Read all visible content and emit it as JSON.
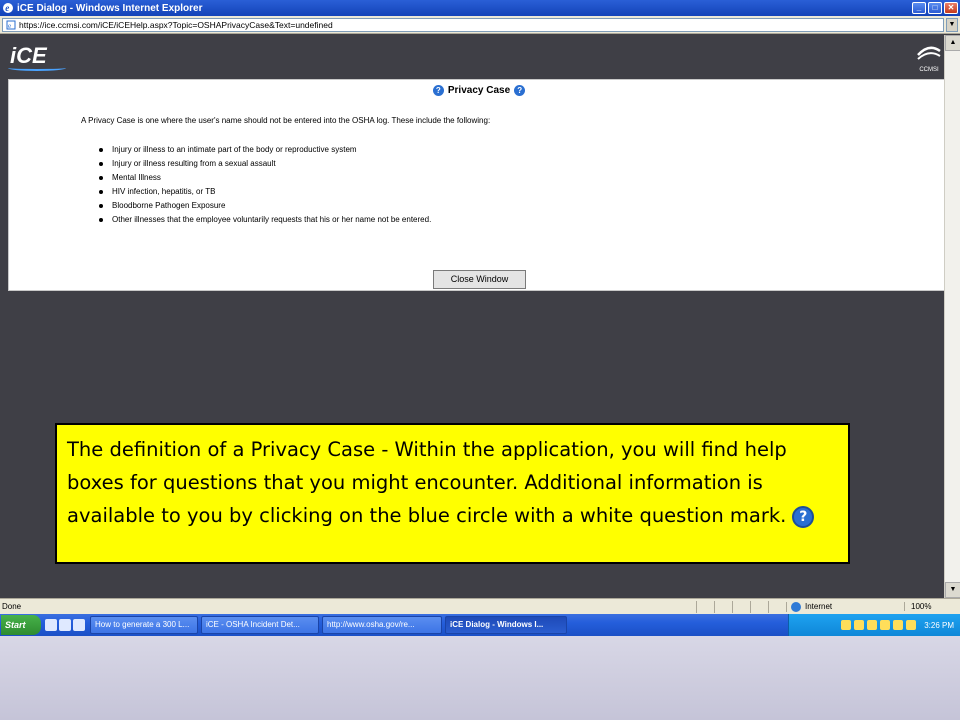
{
  "window": {
    "title": "iCE Dialog - Windows Internet Explorer",
    "url": "https://ice.ccmsi.com/iCE/iCEHelp.aspx?Topic=OSHAPrivacyCase&Text=undefined"
  },
  "header": {
    "logo_text": "iCE",
    "brand_text": "CCMSI"
  },
  "dialog": {
    "title": "Privacy Case",
    "intro": "A Privacy Case is one where the user's name should not be entered into the OSHA log. These include the following:",
    "items": [
      "Injury or illness to an intimate part of the body or reproductive system",
      "Injury or illness resulting from a sexual assault",
      "Mental Illness",
      "HIV infection, hepatitis, or TB",
      "Bloodborne Pathogen Exposure",
      "Other illnesses that the employee voluntarily requests that his or her name not be entered."
    ],
    "close_label": "Close Window"
  },
  "callout": {
    "text": "The definition of a Privacy Case - Within the application, you will find help boxes for questions that you might encounter.  Additional information is available to you by clicking on the blue circle with a white question mark."
  },
  "statusbar": {
    "status": "Done",
    "zone": "Internet",
    "zoom": "100%"
  },
  "taskbar": {
    "start_label": "Start",
    "tasks": [
      "How to generate a 300 L...",
      "iCE - OSHA Incident Det...",
      "http://www.osha.gov/re...",
      "iCE Dialog - Windows I..."
    ],
    "clock": "3:26 PM"
  },
  "colors": {
    "callout_bg": "#ffff00",
    "help_icon": "#2a6fd1",
    "page_bg": "#3f3f46"
  }
}
